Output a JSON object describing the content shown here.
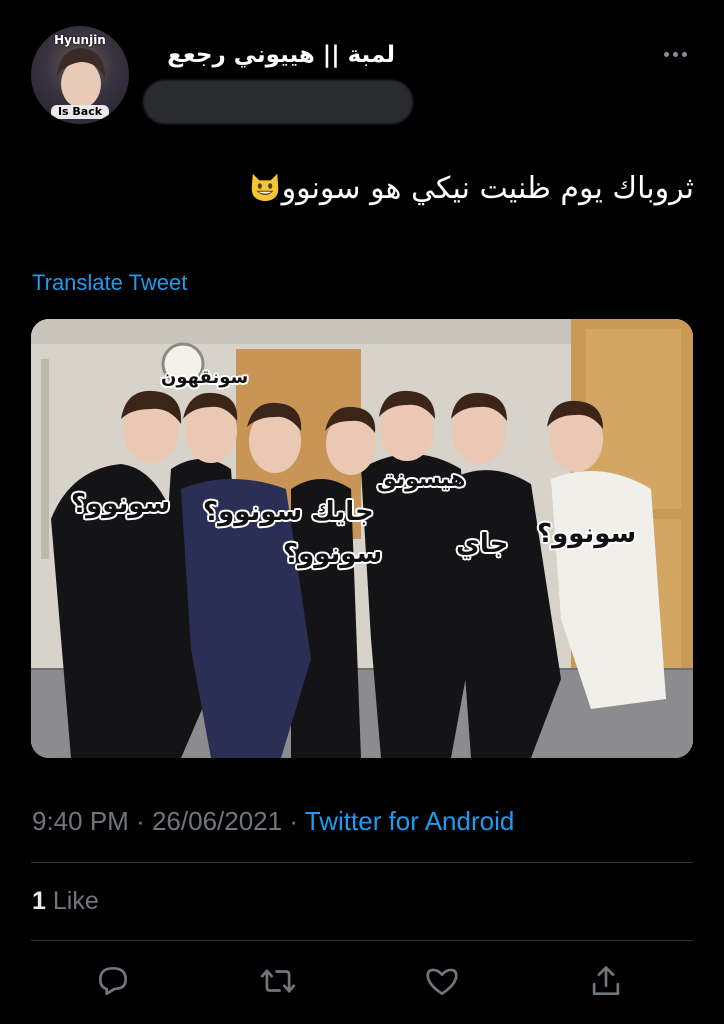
{
  "profile": {
    "avatar_top_text": "Hyunjin",
    "avatar_bottom_text": "Is Back",
    "display_name": "لمبة || هييوني رجعع"
  },
  "tweet": {
    "text": "ثروباك يوم ظنيت نيكي هو سونوو",
    "emoji": "grinning-cat-icon",
    "translate_label": "Translate Tweet"
  },
  "media": {
    "captions": [
      "سونقهون",
      "سونوو؟",
      "جايك سونوو؟",
      "هيسونق",
      "سونوو؟",
      "جاي",
      "سونوو؟"
    ]
  },
  "meta": {
    "time": "9:40 PM",
    "separator": "·",
    "date": "26/06/2021",
    "source": "Twitter for Android"
  },
  "stats": {
    "like_count": "1",
    "like_label": "Like"
  },
  "actions": [
    "reply-icon",
    "retweet-icon",
    "like-icon",
    "share-icon"
  ],
  "colors": {
    "background": "#000000",
    "accent": "#1d9bf0",
    "muted": "#71767b",
    "divider": "#2f3336"
  }
}
